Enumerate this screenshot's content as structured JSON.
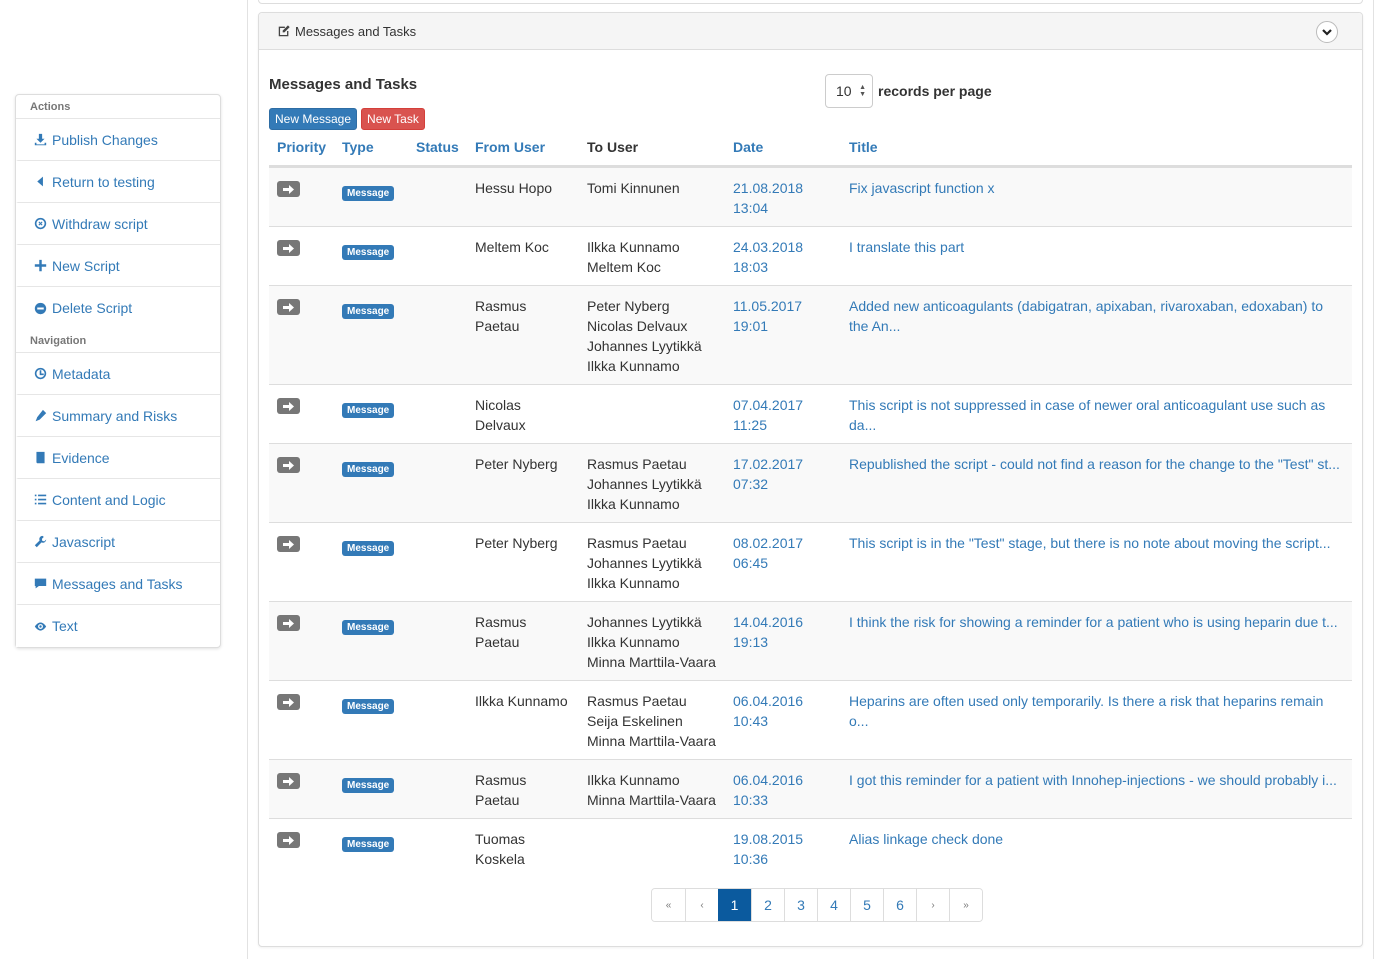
{
  "sidebar": {
    "actions_heading": "Actions",
    "actions": [
      {
        "label": "Publish Changes",
        "icon": "download-icon"
      },
      {
        "label": "Return to testing",
        "icon": "caret-left-icon"
      },
      {
        "label": "Withdraw script",
        "icon": "circle-x-icon"
      },
      {
        "label": "New Script",
        "icon": "plus-icon"
      },
      {
        "label": "Delete Script",
        "icon": "circle-minus-icon"
      }
    ],
    "navigation_heading": "Navigation",
    "navigation": [
      {
        "label": "Metadata",
        "icon": "clock-icon"
      },
      {
        "label": "Summary and Risks",
        "icon": "pencil-icon"
      },
      {
        "label": "Evidence",
        "icon": "book-icon"
      },
      {
        "label": "Content and Logic",
        "icon": "list-icon"
      },
      {
        "label": "Javascript",
        "icon": "wrench-icon"
      },
      {
        "label": "Messages and Tasks",
        "icon": "comment-icon"
      },
      {
        "label": "Text",
        "icon": "eye-icon"
      }
    ]
  },
  "panel": {
    "heading": "Messages and Tasks",
    "section_title": "Messages and Tasks",
    "new_message_label": "New Message",
    "new_task_label": "New Task",
    "records_per_page_value": "10",
    "records_per_page_label": "records per page"
  },
  "table": {
    "headers": {
      "priority": "Priority",
      "type": "Type",
      "status": "Status",
      "from_user": "From User",
      "to_user": "To User",
      "date": "Date",
      "title": "Title"
    },
    "rows": [
      {
        "type": "Message",
        "status": "",
        "from": "Hessu Hopo",
        "to": "Tomi Kinnunen",
        "date": "21.08.2018\n13:04",
        "title": "Fix javascript function x"
      },
      {
        "type": "Message",
        "status": "",
        "from": "Meltem Koc",
        "to": "Ilkka Kunnamo\nMeltem Koc",
        "date": "24.03.2018\n18:03",
        "title": "I translate  this part"
      },
      {
        "type": "Message",
        "status": "",
        "from": "Rasmus\nPaetau",
        "to": "Peter Nyberg\nNicolas Delvaux\nJohannes Lyytikkä\nIlkka Kunnamo",
        "date": "11.05.2017\n19:01",
        "title": "Added new anticoagulants (dabigatran, apixaban, rivaroxaban, edoxaban) to the An..."
      },
      {
        "type": "Message",
        "status": "",
        "from": "Nicolas\nDelvaux",
        "to": "",
        "date": "07.04.2017\n11:25",
        "title": "This script is not suppressed in case of newer oral anticoagulant use such as da..."
      },
      {
        "type": "Message",
        "status": "",
        "from": "Peter Nyberg",
        "to": "Rasmus Paetau\nJohannes Lyytikkä\nIlkka Kunnamo",
        "date": "17.02.2017\n07:32",
        "title": "Republished the script - could not find a reason for the change to the \"Test\" st..."
      },
      {
        "type": "Message",
        "status": "",
        "from": "Peter Nyberg",
        "to": "Rasmus Paetau\nJohannes Lyytikkä\nIlkka Kunnamo",
        "date": "08.02.2017\n06:45",
        "title": "This script is in the \"Test\" stage, but there is no note about moving the script..."
      },
      {
        "type": "Message",
        "status": "",
        "from": "Rasmus\nPaetau",
        "to": "Johannes Lyytikkä\nIlkka Kunnamo\nMinna Marttila-Vaara",
        "date": "14.04.2016\n19:13",
        "title": "I think the risk for showing a reminder for a patient who is using heparin due t..."
      },
      {
        "type": "Message",
        "status": "",
        "from": "Ilkka Kunnamo",
        "to": "Rasmus Paetau\nSeija Eskelinen\nMinna Marttila-Vaara",
        "date": "06.04.2016\n10:43",
        "title": "Heparins are often used only temporarily. Is there a risk that heparins remain o..."
      },
      {
        "type": "Message",
        "status": "",
        "from": "Rasmus\nPaetau",
        "to": "Ilkka Kunnamo\nMinna Marttila-Vaara",
        "date": "06.04.2016\n10:33",
        "title": "I got this reminder for a patient with Innohep-injections - we should probably i..."
      },
      {
        "type": "Message",
        "status": "",
        "from": "Tuomas\nKoskela",
        "to": "",
        "date": "19.08.2015\n10:36",
        "title": "Alias linkage check done"
      }
    ]
  },
  "pagination": {
    "first": "«",
    "prev": "‹",
    "pages": [
      "1",
      "2",
      "3",
      "4",
      "5",
      "6"
    ],
    "active_page": "1",
    "next": "›",
    "last": "»"
  },
  "colors": {
    "link": "#337ab7",
    "primary": "#337ab7",
    "danger": "#d9534f",
    "active_page": "#0b5a9e",
    "arrow_button": "#777777"
  }
}
